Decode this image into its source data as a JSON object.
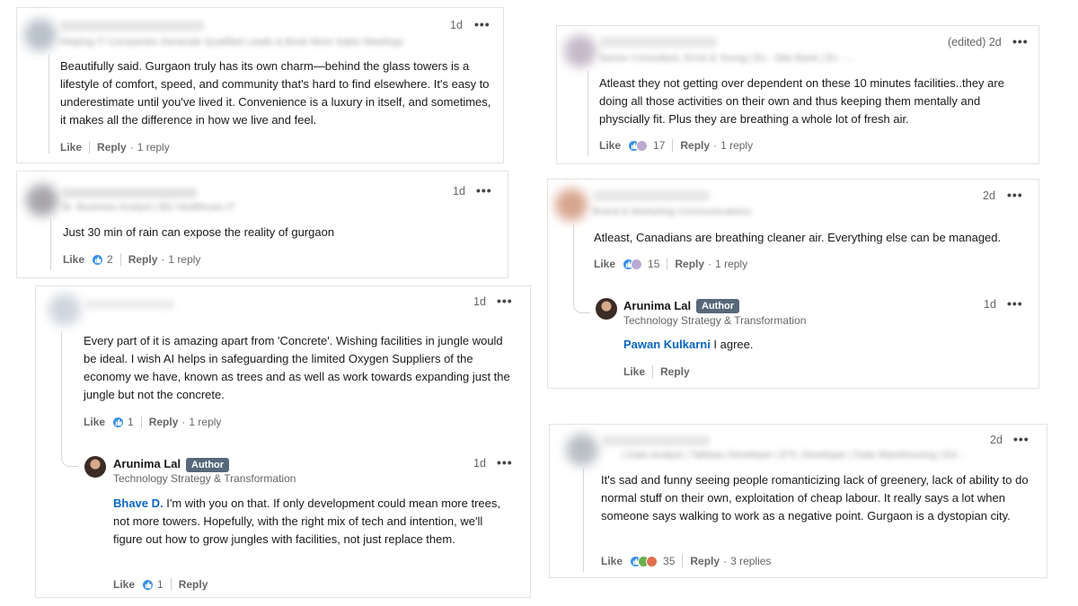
{
  "labels": {
    "like": "Like",
    "reply": "Reply",
    "author_badge": "Author",
    "more": "•••"
  },
  "colors": {
    "mention": "#0a66c2",
    "badge": "#56687a",
    "like_reaction": "#378fe9",
    "clap_reaction": "#6dae4f",
    "heart_reaction": "#df704d"
  },
  "comments": [
    {
      "time": "1d",
      "headline": "Helping IT Companies Generate Qualified Leads & Book More Sales Meetings",
      "text": "Beautifully said. Gurgaon truly has its own charm—behind the glass towers is a lifestyle of comfort, speed, and community that's hard to find elsewhere. It's easy to underestimate until you've lived it. Convenience is a luxury in itself, and sometimes, it makes all the difference in how we live and feel.",
      "replies": "1 reply"
    },
    {
      "time": "1d",
      "headline": "Sr. Business Analyst | BD Healthcare IT",
      "text": "Just 30 min of rain can expose the reality of gurgaon",
      "reactions": "2",
      "reaction_icons": [
        "like-icon"
      ],
      "replies": "1 reply"
    },
    {
      "time": "1d",
      "text": "Every part of it is amazing apart from 'Concrete'. Wishing facilities in jungle would be ideal. I wish AI helps in safeguarding the limited Oxygen Suppliers of the economy we have, known as trees and as well as work towards expanding just the jungle but not the concrete.",
      "reactions": "1",
      "reaction_icons": [
        "like-icon"
      ],
      "replies": "1 reply",
      "reply": {
        "name": "Arunima Lal",
        "title": "Technology Strategy & Transformation",
        "time": "1d",
        "mention": "Bhave D.",
        "text": " I'm with you on that. If only development could mean more trees, not more towers. Hopefully, with the right mix of tech and intention, we'll figure out how to grow jungles with facilities, not just replace them.",
        "reactions": "1",
        "reaction_icons": [
          "like-icon"
        ]
      }
    },
    {
      "time": "(edited) 2d",
      "headline": "Senior Consultant, Ernst & Young | Ex - Dbs Bank | Ex - ...",
      "text": "Atleast they not getting over dependent on these 10 minutes facilities..they are doing all those activities on their own and thus keeping them mentally and physcially fit. Plus they are breathing a whole lot of fresh air.",
      "reactions": "17",
      "reaction_icons": [
        "like-icon",
        "support-icon"
      ],
      "replies": "1 reply"
    },
    {
      "time": "2d",
      "headline": "Brand & Marketing Communications",
      "text": "Atleast, Canadians are breathing cleaner air. Everything else can be managed.",
      "reactions": "15",
      "reaction_icons": [
        "like-icon",
        "support-icon"
      ],
      "replies": "1 reply",
      "reply": {
        "name": "Arunima Lal",
        "title": "Technology Strategy & Transformation",
        "time": "1d",
        "mention": "Pawan Kulkarni",
        "text": " I agree."
      }
    },
    {
      "time": "2d",
      "headline": "| Data Analyst | Tableau Developer | ETL Developer | Data Warehousing | Ed...",
      "text": "It's sad and funny seeing people romanticizing lack of greenery, lack of ability to do normal stuff on their own, exploitation of cheap labour. It really says a lot when someone says walking to work as a negative point. Gurgaon is a dystopian city.",
      "reactions": "35",
      "reaction_icons": [
        "like-icon",
        "clap-icon",
        "heart-icon"
      ],
      "replies": "3 replies"
    }
  ]
}
